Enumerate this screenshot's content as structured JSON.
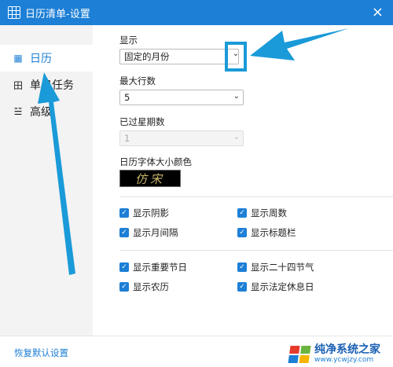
{
  "window": {
    "title": "日历清单-设置",
    "close_icon": "×"
  },
  "sidebar": {
    "items": [
      {
        "icon": "calendar-icon",
        "glyph": "▦",
        "label": "日历"
      },
      {
        "icon": "grid-icon",
        "glyph": "田",
        "label": "单日任务"
      },
      {
        "icon": "sliders-icon",
        "glyph": "☱",
        "label": "高级"
      }
    ]
  },
  "display": {
    "label": "显示",
    "selected": "固定的月份",
    "max_rows_label": "最大行数",
    "max_rows_value": "5",
    "past_weeks_label": "已过星期数",
    "past_weeks_value": "1",
    "font_color_label": "日历字体大小颜色",
    "font_preview_text": "仿宋"
  },
  "checkboxes": [
    {
      "label": "显示阴影",
      "checked": true
    },
    {
      "label": "显示周数",
      "checked": true
    },
    {
      "label": "显示月间隔",
      "checked": true
    },
    {
      "label": "显示标题栏",
      "checked": true
    },
    {
      "label": "显示重要节日",
      "checked": true
    },
    {
      "label": "显示二十四节气",
      "checked": true
    },
    {
      "label": "显示农历",
      "checked": true
    },
    {
      "label": "显示法定休息日",
      "checked": true
    }
  ],
  "footer": {
    "reset_label": "恢复默认设置",
    "watermark_title": "纯净系统之家",
    "watermark_url": "www.ycwjzy.com"
  },
  "colors": {
    "accent": "#1d7fd6",
    "annotation": "#1a9ad8"
  }
}
